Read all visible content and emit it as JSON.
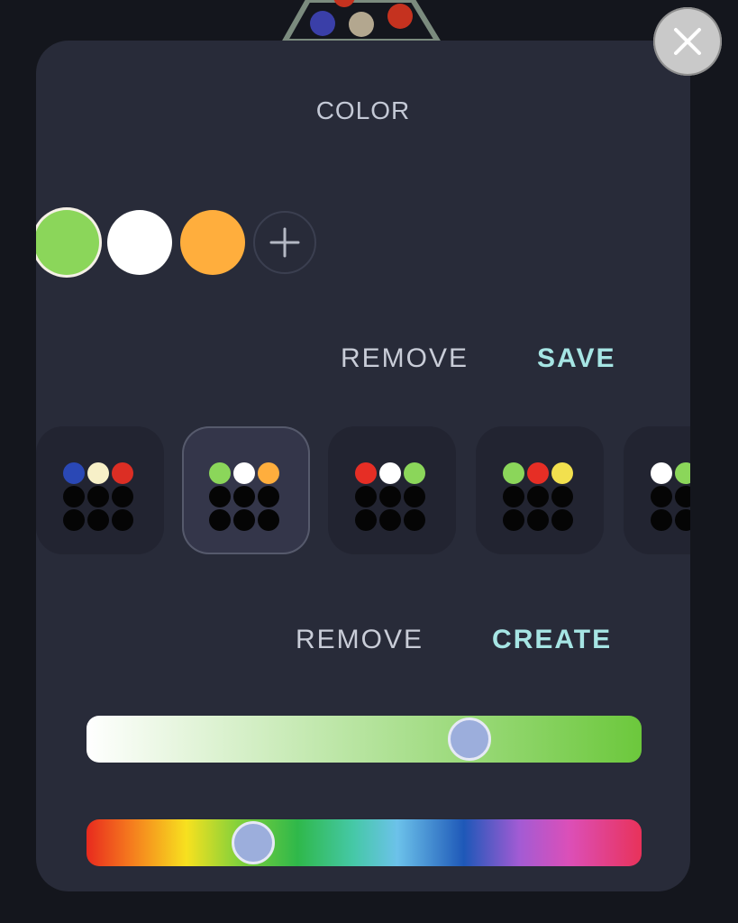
{
  "title": "COLOR",
  "close_icon": "close-icon",
  "swatches": [
    {
      "color": "#8bd65a",
      "selected": true
    },
    {
      "color": "#ffffff",
      "selected": false
    },
    {
      "color": "#ffae3d",
      "selected": false
    }
  ],
  "add_swatch_icon": "plus-icon",
  "swatch_actions": {
    "remove": "REMOVE",
    "save": "SAVE"
  },
  "presets": [
    {
      "colors": [
        "#2a48b5",
        "#f7f0c8",
        "#dc2e24"
      ],
      "selected": false
    },
    {
      "colors": [
        "#8bd65a",
        "#ffffff",
        "#ffae3d"
      ],
      "selected": true
    },
    {
      "colors": [
        "#e62e25",
        "#ffffff",
        "#8bd65a"
      ],
      "selected": false
    },
    {
      "colors": [
        "#8bd65a",
        "#e62e25",
        "#f2e04e"
      ],
      "selected": false
    },
    {
      "colors": [
        "#ffffff",
        "#8bd65a",
        "#000000"
      ],
      "selected": false
    }
  ],
  "preset_actions": {
    "remove": "REMOVE",
    "create": "CREATE"
  },
  "brightness_slider": {
    "value": 0.69,
    "colors": [
      "#ffffff",
      "#6cc83c"
    ]
  },
  "hue_slider": {
    "value": 0.3
  },
  "colors": {
    "accent": "#a6e5e4",
    "panel": "#282b39",
    "background": "#14161d"
  }
}
